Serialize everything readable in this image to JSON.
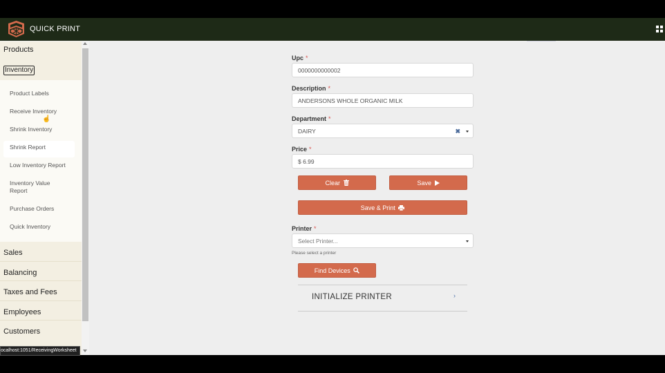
{
  "app": {
    "title": "QUICK PRINT"
  },
  "sidebar": {
    "sections_top": [
      {
        "label": "Products"
      },
      {
        "label": "Inventory"
      }
    ],
    "inventory_items": [
      {
        "label": "Product Labels"
      },
      {
        "label": "Receive Inventory"
      },
      {
        "label": "Shrink Inventory"
      },
      {
        "label": "Shrink Report"
      },
      {
        "label": "Low Inventory Report"
      },
      {
        "label": "Inventory Value Report"
      },
      {
        "label": "Purchase Orders"
      },
      {
        "label": "Quick Inventory"
      }
    ],
    "sections_bottom": [
      {
        "label": "Sales"
      },
      {
        "label": "Balancing"
      },
      {
        "label": "Taxes and Fees"
      },
      {
        "label": "Employees"
      },
      {
        "label": "Customers"
      }
    ]
  },
  "form": {
    "upc": {
      "label": "Upc",
      "required": "*",
      "value": "0000000000002"
    },
    "description": {
      "label": "Description",
      "required": "*",
      "value": "ANDERSONS WHOLE ORGANIC MILK"
    },
    "department": {
      "label": "Department",
      "required": "*",
      "value": "DAIRY",
      "clear_glyph": "✖"
    },
    "price": {
      "label": "Price",
      "required": "*",
      "value": "$ 6.99"
    },
    "buttons": {
      "clear": "Clear",
      "save": "Save",
      "save_print": "Save & Print",
      "find_devices": "Find Devices"
    },
    "printer": {
      "label": "Printer",
      "required": "*",
      "placeholder": "Select Printer...",
      "help": "Please select a printer"
    },
    "initialize": {
      "label": "INITIALIZE PRINTER",
      "chevron": "›"
    }
  },
  "status_bar": {
    "url": "ocalhost:1051/ReceivingWorksheet"
  },
  "colors": {
    "accent": "#d36a4c",
    "topbar": "#1e2a17",
    "sidebar": "#f3efe2"
  },
  "icons": [
    "logo-icon",
    "apps-grid-icon",
    "trash-icon",
    "play-icon",
    "printer-icon",
    "search-icon",
    "chevron-right-icon",
    "chevron-down-icon",
    "close-icon"
  ]
}
